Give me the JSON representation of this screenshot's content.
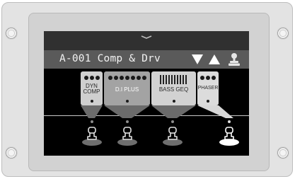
{
  "device": {
    "screws": [
      "screw-icon",
      "screw-icon",
      "screw-icon",
      "screw-icon"
    ]
  },
  "screen": {
    "pull_down_handle_icon": "chevron-down-icon",
    "patch_name": "A-001 Comp & Drv",
    "nav_down_icon": "triangle-down-icon",
    "nav_up_icon": "triangle-up-icon",
    "tuner_icon": "tuner-icon"
  },
  "effects": [
    {
      "label": "DYN\nCOMP",
      "style": "pedal",
      "selected": false
    },
    {
      "label": "D.I PLUS",
      "style": "rack",
      "selected": false
    },
    {
      "label": "BASS GEQ",
      "style": "geq",
      "selected": false
    },
    {
      "label": "PHASER",
      "style": "pedal",
      "selected": true
    }
  ],
  "footswitches": [
    {
      "name": "footswitch-1",
      "active": false
    },
    {
      "name": "footswitch-2",
      "active": false
    },
    {
      "name": "footswitch-3",
      "active": false
    },
    {
      "name": "footswitch-4",
      "active": true
    }
  ],
  "colors": {
    "screen_bg": "#000000",
    "title_bar": "#5a5a5a",
    "effect_light": "#d6d6d6",
    "effect_dark": "#9e9e9e",
    "funnel": "#6b6b6b",
    "funnel_active": "#d8d8d8",
    "switch_ring": "#6e6e6e",
    "switch_ring_active": "#ffffff"
  }
}
